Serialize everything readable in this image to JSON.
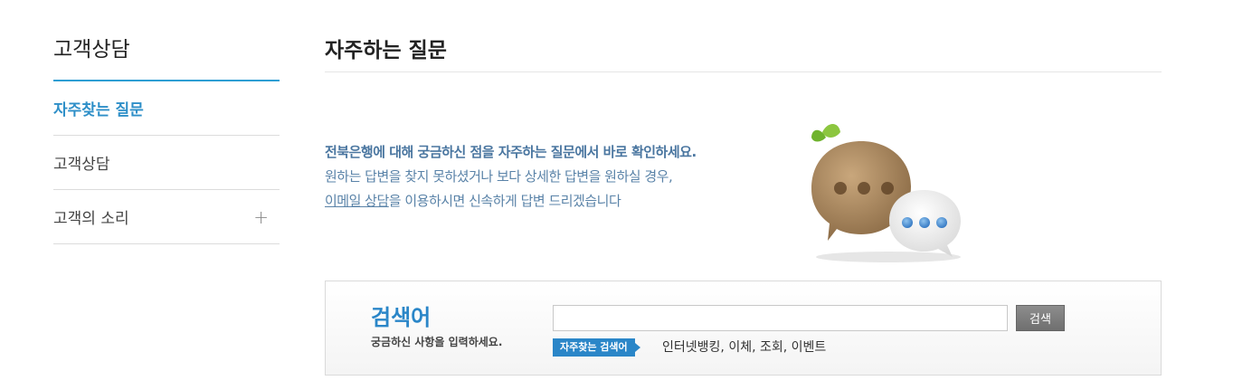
{
  "sidebar": {
    "title": "고객상담",
    "items": [
      {
        "label": "자주찾는 질문",
        "active": true
      },
      {
        "label": "고객상담",
        "active": false
      },
      {
        "label": "고객의 소리",
        "active": false,
        "expand": "+"
      }
    ]
  },
  "main": {
    "title": "자주하는 질문",
    "intro": {
      "line1": "전북은행에 대해 궁금하신 점을 자주하는 질문에서 바로 확인하세요.",
      "line2": "원하는 답변을 찾지 못하셨거나 보다 상세한 답변을 원하실 경우,",
      "line3_link": "이메일 상담",
      "line3_rest": "을 이용하시면 신속하게 답변 드리겠습니다"
    },
    "search": {
      "title": "검색어",
      "subtitle": "궁금하신 사항을 입력하세요.",
      "input_value": "",
      "button_label": "검색",
      "tag_label": "자주찾는 검색어",
      "keywords": [
        "인터넷뱅킹",
        "이체",
        "조회",
        "이벤트"
      ],
      "separator": ", "
    }
  },
  "colors": {
    "accent": "#2e9ed3",
    "link_blue": "#2a86c8",
    "intro_text": "#5a83a8"
  }
}
